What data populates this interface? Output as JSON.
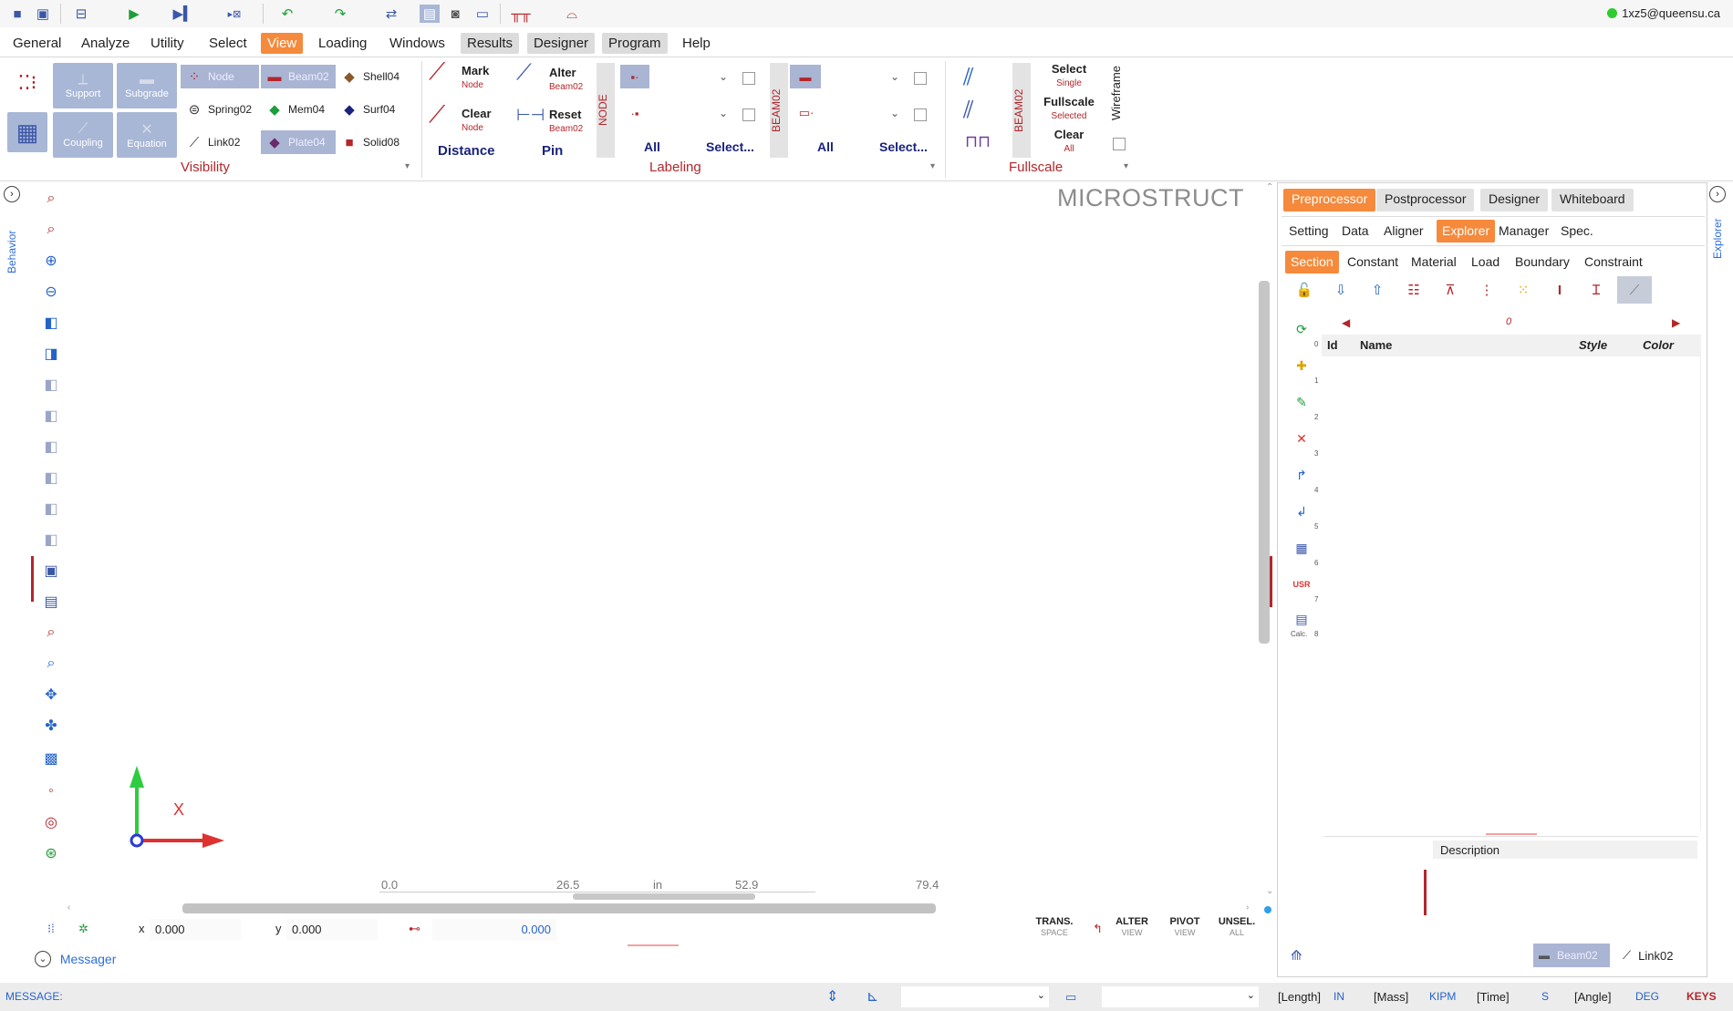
{
  "user": "1xz5@queensu.ca",
  "quick_toolbar": [
    {
      "name": "save-icon",
      "glyph": "💾"
    },
    {
      "name": "save-as-icon",
      "glyph": "🗎"
    },
    {
      "name": "model-icon",
      "glyph": "⊟"
    },
    {
      "name": "run-icon",
      "glyph": "▶"
    },
    {
      "name": "step-run-icon",
      "glyph": "⏭"
    },
    {
      "name": "batch-run-icon",
      "glyph": "▸⊠"
    },
    {
      "name": "undo-icon",
      "glyph": "↶"
    },
    {
      "name": "redo-icon",
      "glyph": "↷"
    },
    {
      "name": "swap-icon",
      "glyph": "⇄"
    },
    {
      "name": "layout-icon",
      "glyph": "▤"
    },
    {
      "name": "camera-icon",
      "glyph": "📷"
    },
    {
      "name": "window-icon",
      "glyph": "▭"
    },
    {
      "name": "frame-icon",
      "glyph": "⊓"
    },
    {
      "name": "arch-icon",
      "glyph": "⌓"
    }
  ],
  "menu": [
    "General",
    "Analyze",
    "Utility",
    "Select",
    "View",
    "Loading",
    "Windows",
    "Results",
    "Designer",
    "Program",
    "Help"
  ],
  "ribbon": {
    "visibility": {
      "label": "Visibility",
      "tiles": [
        "Support",
        "Subgrade",
        "Coupling",
        "Equation"
      ],
      "elements": [
        "Node",
        "Beam02",
        "Shell04",
        "Spring02",
        "Mem04",
        "Surf04",
        "Link02",
        "Plate04",
        "Solid08"
      ]
    },
    "labeling": {
      "label": "Labeling",
      "mark": {
        "title": "Mark",
        "sub": "Node"
      },
      "clear": {
        "title": "Clear",
        "sub": "Node"
      },
      "alter": {
        "title": "Alter",
        "sub": "Beam02"
      },
      "reset": {
        "title": "Reset",
        "sub": "Beam02"
      },
      "distance": "Distance",
      "pin": "Pin",
      "node_tag": "NODE",
      "beam_tag": "BEAM02",
      "all": "All",
      "select": "Select..."
    },
    "fullscale": {
      "label": "Fullscale",
      "beam_tag": "BEAM02",
      "select": {
        "title": "Select",
        "sub": "Single"
      },
      "fullscale": {
        "title": "Fullscale",
        "sub": "Selected"
      },
      "clear": {
        "title": "Clear",
        "sub": "All"
      },
      "wireframe": "Wireframe"
    }
  },
  "side_tabs": {
    "left": "Behavior",
    "right": "Explorer"
  },
  "viewport": {
    "brand": "MICROSTRUCT",
    "axis_x_label": "X",
    "scale_ticks": [
      "0.0",
      "26.5",
      "in",
      "52.9",
      "79.4"
    ]
  },
  "coordbar": {
    "x_label": "x",
    "x_value": "0.000",
    "y_label": "y",
    "y_value": "0.000",
    "dist_value": "0.000",
    "modes": [
      {
        "title": "TRANS.",
        "sub": "SPACE"
      },
      {
        "title": "ALTER",
        "sub": "VIEW"
      },
      {
        "title": "PIVOT",
        "sub": "VIEW"
      },
      {
        "title": "UNSEL.",
        "sub": "ALL"
      }
    ]
  },
  "messager": "Messager",
  "statusbar": {
    "message_label": "MESSAGE:",
    "units": [
      {
        "label": "[Length]",
        "value": "IN"
      },
      {
        "label": "[Mass]",
        "value": "KIPM"
      },
      {
        "label": "[Time]",
        "value": "S"
      },
      {
        "label": "[Angle]",
        "value": "DEG"
      }
    ],
    "keys": "KEYS"
  },
  "panel": {
    "top_tabs": [
      "Preprocessor",
      "Postprocessor",
      "Designer",
      "Whiteboard"
    ],
    "sub_tabs": [
      "Setting",
      "Data",
      "Aligner",
      "Explorer",
      "Manager",
      "Spec."
    ],
    "section_tabs": [
      "Section",
      "Constant",
      "Material",
      "Load",
      "Boundary",
      "Constraint"
    ],
    "page_index": "0",
    "columns": [
      "Id",
      "Name",
      "Style",
      "Color"
    ],
    "side_numbers": [
      "0",
      "1",
      "2",
      "3",
      "4",
      "5",
      "6",
      "7",
      "8"
    ],
    "calc_label": "Calc.",
    "usr_label": "USR",
    "description_label": "Description",
    "bottom_beam": "Beam02",
    "bottom_link": "Link02"
  },
  "colors": {
    "accent": "#f58a3c",
    "brand_red": "#b3262b",
    "tile": "#a9b7d6",
    "link_blue": "#2563c9"
  }
}
